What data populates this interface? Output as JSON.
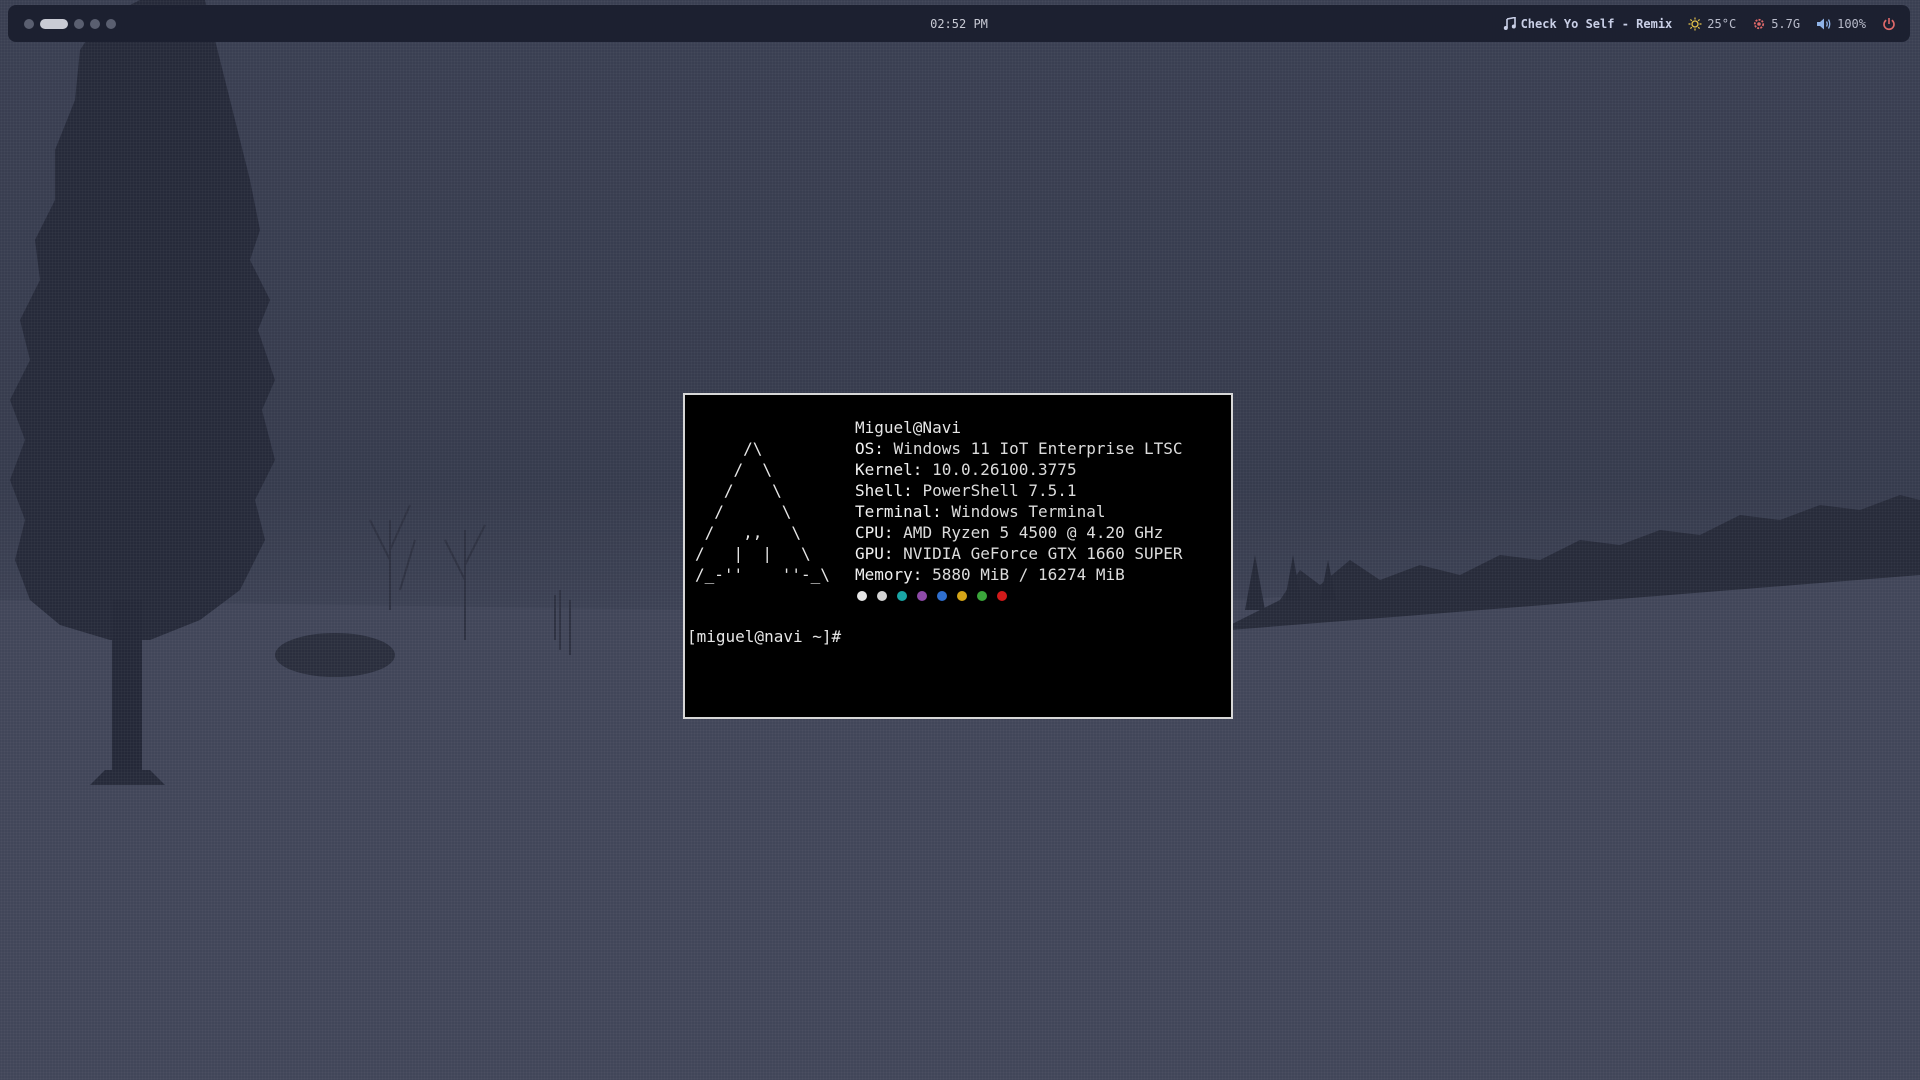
{
  "topbar": {
    "workspaces": [
      {
        "active": false
      },
      {
        "active": true
      },
      {
        "active": false
      },
      {
        "active": false
      },
      {
        "active": false
      }
    ],
    "clock": "02:52 PM",
    "media_icon": "music-note-icon",
    "media_title": "Check Yo Self - Remix",
    "weather_icon": "sun-icon",
    "temperature": "25°C",
    "memory_icon": "gear-icon",
    "memory": "5.7G",
    "volume_icon": "speaker-icon",
    "volume": "100%",
    "power_icon": "power-icon"
  },
  "terminal": {
    "ascii_art": "     /\\\n    /  \\\n   /    \\\n  /      \\\n /   ,,   \\\n/   |  |   \\\n/_-''    ''-_\\",
    "user_host": "Miguel@Navi",
    "info": [
      {
        "key": "OS:",
        "value": "Windows 11 IoT Enterprise LTSC"
      },
      {
        "key": "Kernel:",
        "value": "10.0.26100.3775"
      },
      {
        "key": "Shell:",
        "value": "PowerShell 7.5.1"
      },
      {
        "key": "Terminal:",
        "value": "Windows Terminal"
      },
      {
        "key": "CPU:",
        "value": "AMD Ryzen 5 4500 @ 4.20 GHz"
      },
      {
        "key": "GPU:",
        "value": "NVIDIA GeForce GTX 1660 SUPER"
      },
      {
        "key": "Memory:",
        "value": "5880 MiB / 16274 MiB"
      }
    ],
    "palette": [
      "#e6e6e6",
      "#d4d4d4",
      "#1aa5a5",
      "#8e4aa8",
      "#2f6fcf",
      "#d6a517",
      "#3aa53a",
      "#d21a1a"
    ],
    "prompt": "[miguel@navi ~]#"
  },
  "colors": {
    "bar_bg": "#1c2030",
    "desktop_bg": "#33384a",
    "terminal_bg": "#000000",
    "terminal_border": "#d7d7d7"
  }
}
